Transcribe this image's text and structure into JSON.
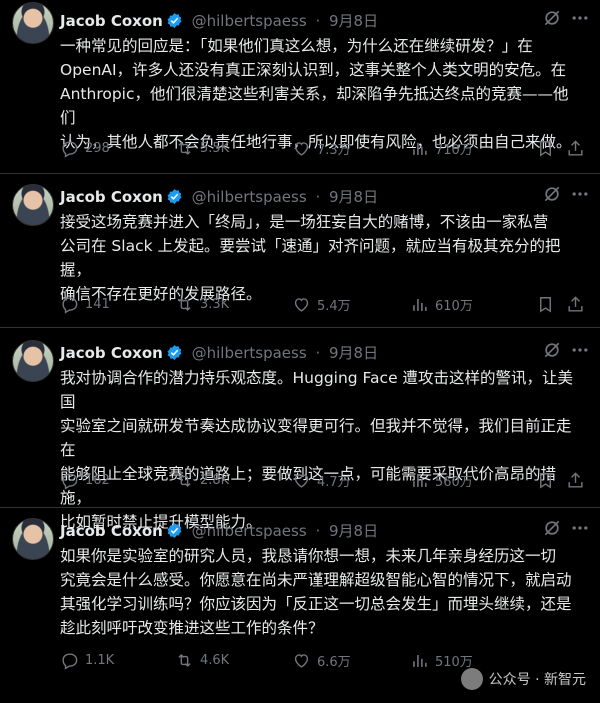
{
  "author": {
    "name": "Jacob Coxon",
    "handle": "@hilbertspaess",
    "date": "9月8日"
  },
  "tweets": [
    {
      "text": "一种常见的回应是：「如果他们真这么想，为什么还在继续研发？」在\nOpenAI，许多人还没有真正深刻认识到，这事关整个人类文明的安危。在\nAnthropic，他们很清楚这些利害关系，却深陷争先抵达终点的竞赛——他们\n认为，其他人都不会负责任地行事，所以即使有风险，也必须由自己来做。",
      "replies": "298",
      "retweets": "5.5K",
      "likes": "7.3万",
      "views": "710万"
    },
    {
      "text": "接受这场竞赛并进入「终局」，是一场狂妄自大的赌博，不该由一家私营\n公司在 Slack 上发起。要尝试「速通」对齐问题，就应当有极其充分的把握，\n确信不存在更好的发展路径。",
      "replies": "141",
      "retweets": "3.3K",
      "likes": "5.4万",
      "views": "610万"
    },
    {
      "text": "我对协调合作的潜力持乐观态度。Hugging Face 遭攻击这样的警讯，让美国\n实验室之间就研发节奏达成协议变得更可行。但我并不觉得，我们目前正走在\n能够阻止全球竞赛的道路上；要做到这一点，可能需要采取代价高昂的措施，\n比如暂时禁止提升模型能力。",
      "replies": "162",
      "retweets": "2.8K",
      "likes": "4.7万",
      "views": "560万"
    },
    {
      "text": "如果你是实验室的研究人员，我恳请你想一想，未来几年亲身经历这一切\n究竟会是什么感受。你愿意在尚未严谨理解超级智能心智的情况下，就启动\n其强化学习训练吗？你应该因为「反正这一切总会发生」而埋头继续，还是\n趁此刻呼吁改变推进这些工作的条件？",
      "replies": "1.1K",
      "retweets": "4.6K",
      "likes": "6.6万",
      "views": "510万"
    }
  ],
  "watermark": {
    "text": "公众号 · 新智元"
  },
  "colors": {
    "background": "#000000",
    "text": "#e7e9ea",
    "muted": "#71767b",
    "verified": "#1d9bf0",
    "divider": "#2f3336"
  }
}
